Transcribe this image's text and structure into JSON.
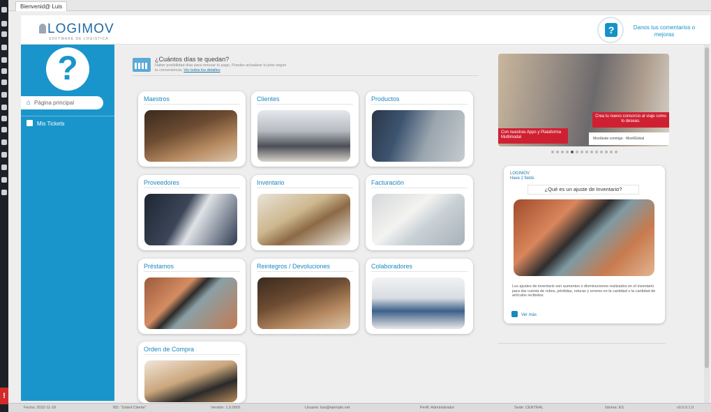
{
  "tab": {
    "label": "Bienvenid@ Luis"
  },
  "header": {
    "logo": "LOGIMOV",
    "logo_sub": "SOFTWARE DE LOGISTICA",
    "help_glyph": "?",
    "feedback": "Danos tus comentarios o mejoras"
  },
  "sidebar": {
    "avatar_glyph": "?",
    "home": "Página principal",
    "ticket": "Mis Tickets"
  },
  "intro": {
    "title": "¿Cuántos días te quedan?",
    "text": "Haber posibilidad días para renovar tu pago. Puedes actualizar tu plan según tu conveniencia.",
    "link": "Ver todos los detalles"
  },
  "cards": [
    {
      "label": "Maestros"
    },
    {
      "label": "Clientes"
    },
    {
      "label": "Productos"
    },
    {
      "label": "Proveedores"
    },
    {
      "label": "Inventario"
    },
    {
      "label": "Facturación"
    },
    {
      "label": "Préstamos"
    },
    {
      "label": "Reintegros / Devoluciones"
    },
    {
      "label": "Colaboradores"
    },
    {
      "label": "Orden de Compra"
    }
  ],
  "banner": {
    "left_text": "Con nuestras Apps y Plataforma Multimodal",
    "right_text": "Crea tu nuevo consorcio al viaje como lo deseas.",
    "footer_text": "Movilizate conmigo  ·  MovilGlobal",
    "dot_count": 14,
    "active_dot": 4
  },
  "faq": {
    "brand": "LOGIMOV",
    "brand_sub": "Have 2 fields",
    "title": "¿Qué es un ajuste de Inventario?",
    "text": "Los ajustes de inventario son aumentos o disminuciones realizados en el inventario para dar cuenta de robos, pérdidas, roturas y errores en la cantidad o la cantidad de artículos recibidos.",
    "button": "Ver más"
  },
  "statusbar": {
    "items": [
      "Fecha: 2022-11-18",
      "BD: \"Usted Cliente\"",
      "Versión: 1.0.0001",
      "Usuario: luis@ejemplo.net",
      "Perfil: Administrador",
      "Sede: CENTRAL",
      "Idioma: ES",
      "v0.0.0.1.0"
    ]
  },
  "colors": {
    "brand_blue": "#1a95cb",
    "title_blue": "#1a88c0",
    "alert_red": "#d22b2b",
    "banner_red": "#cf2032"
  }
}
